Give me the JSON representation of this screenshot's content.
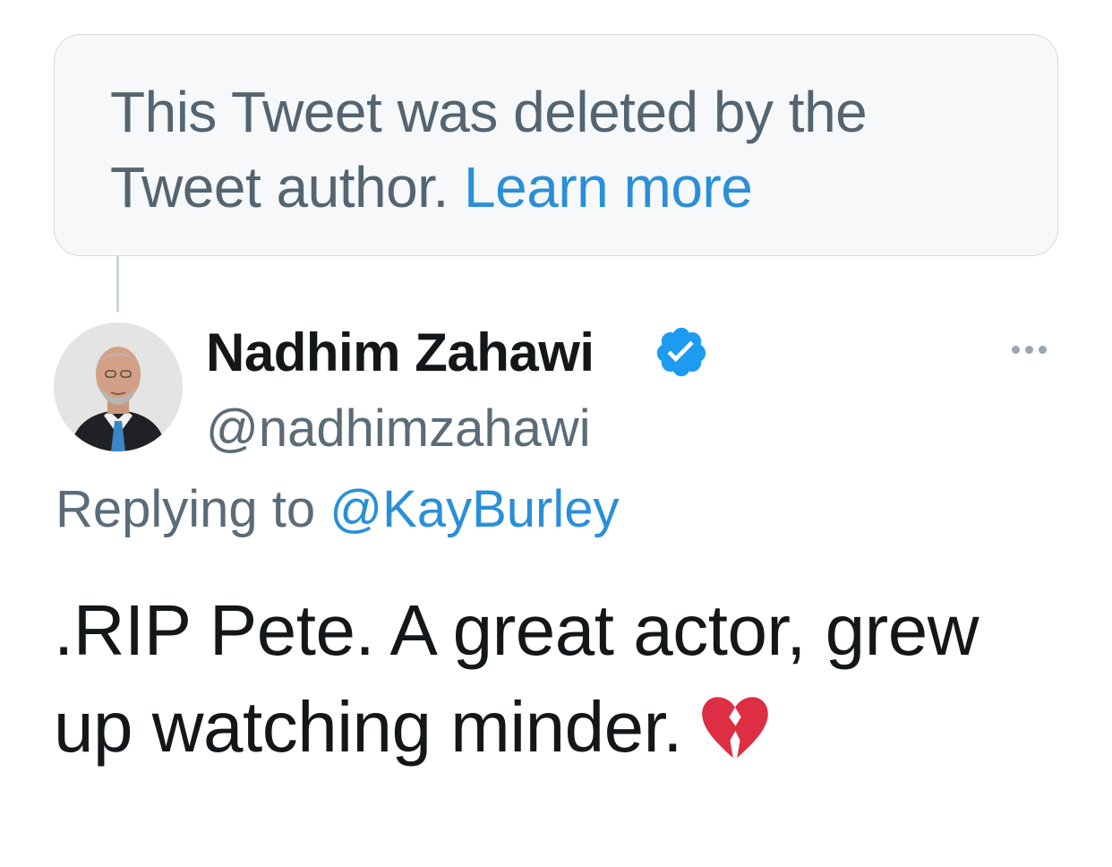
{
  "deleted_notice": {
    "text": "This Tweet was deleted by the Tweet author. ",
    "link": "Learn more"
  },
  "tweet": {
    "author_name": "Nadhim Zahawi",
    "author_handle": "@nadhimzahawi",
    "verified": true,
    "replying_prefix": "Replying to ",
    "replying_handle": "@KayBurley",
    "body": ".RIP Pete. A great actor, grew up watching minder.",
    "emoji": "broken-heart"
  },
  "colors": {
    "link": "#2a8fd8",
    "muted_text": "#5b6c78",
    "primary_text": "#14171a",
    "verified_badge": "#1d9bf0"
  }
}
